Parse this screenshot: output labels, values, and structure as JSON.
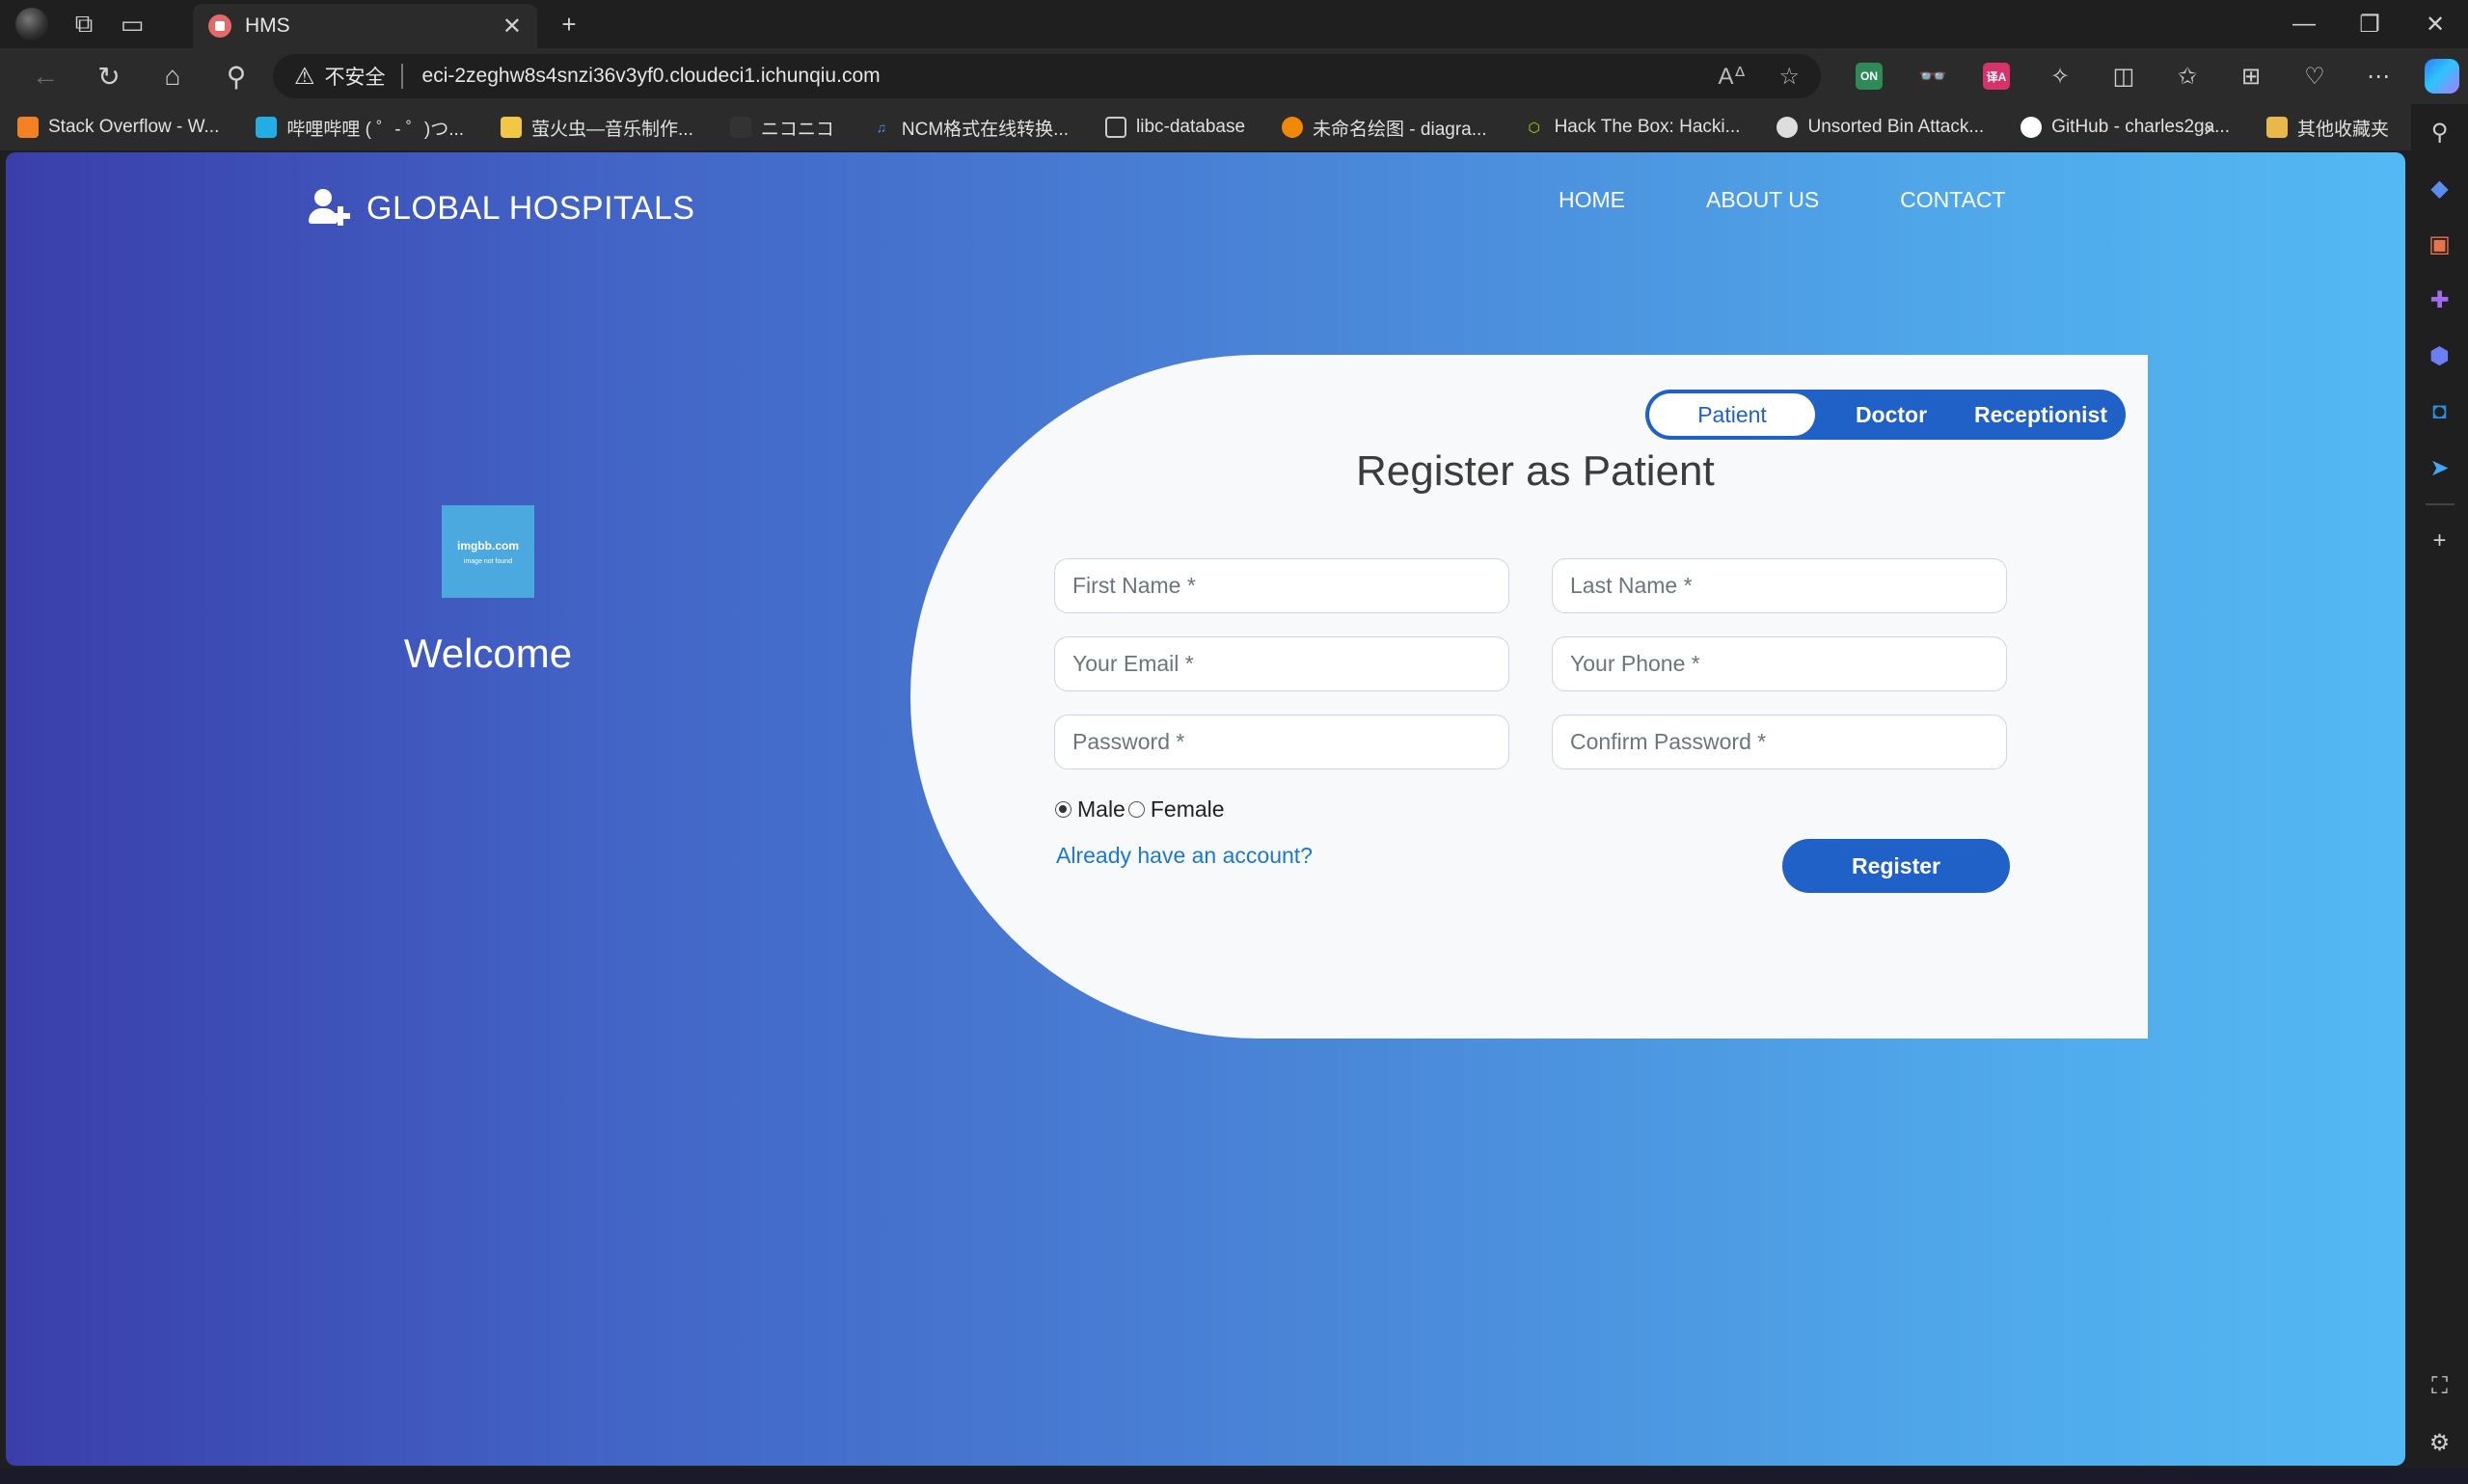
{
  "browser": {
    "tab_title": "HMS",
    "tab_close": "✕",
    "new_tab": "+",
    "insecure_label": "不安全",
    "url": "eci-2zeghw8s4snzi36v3yf0.cloudeci1.ichunqiu.com",
    "minimize": "—",
    "restore": "❐",
    "close": "✕",
    "bookmarks": [
      {
        "label": "Stack Overflow - W...",
        "icon": "stackoverflow-icon",
        "color": "#f48024"
      },
      {
        "label": "哔哩哔哩 ( ゜- ゜)つ...",
        "icon": "bilibili-icon",
        "color": "#23ade5"
      },
      {
        "label": "萤火虫—音乐制作...",
        "icon": "envelope-icon",
        "color": "#f2c744"
      },
      {
        "label": "ニコニコ",
        "icon": "niconico-icon",
        "color": "#333333"
      },
      {
        "label": "NCM格式在线转换...",
        "icon": "music-note-icon",
        "color": "#4a90e2"
      },
      {
        "label": "libc-database",
        "icon": "page-icon",
        "color": "#cccccc"
      },
      {
        "label": "未命名绘图 - diagra...",
        "icon": "drawio-icon",
        "color": "#f08705"
      },
      {
        "label": "Hack The Box: Hacki...",
        "icon": "hackthebox-icon",
        "color": "#9fef00"
      },
      {
        "label": "Unsorted Bin Attack...",
        "icon": "ctf-wiki-icon",
        "color": "#dddddd"
      },
      {
        "label": "GitHub - charles2ga...",
        "icon": "github-icon",
        "color": "#ffffff"
      }
    ],
    "other_bookmarks": "其他收藏夹",
    "extension_badge_on": "ON",
    "extension_badge_translate": "译A"
  },
  "site": {
    "brand_name": "GLOBAL HOSPITALS",
    "nav": {
      "home": "HOME",
      "about": "ABOUT US",
      "contact": "CONTACT"
    },
    "welcome": {
      "img_site": "imgbb.com",
      "img_message": "image not found",
      "title": "Welcome"
    }
  },
  "form": {
    "roles": {
      "patient": "Patient",
      "doctor": "Doctor",
      "receptionist": "Receptionist"
    },
    "title": "Register as Patient",
    "fields": {
      "first_name": "First Name *",
      "last_name": "Last Name *",
      "email": "Your Email *",
      "phone": "Your Phone *",
      "password": "Password *",
      "confirm_password": "Confirm Password *"
    },
    "gender": {
      "male": "Male",
      "female": "Female",
      "selected": "male"
    },
    "login_link": "Already have an account?",
    "submit_label": "Register"
  },
  "colors": {
    "primary": "#1f61c6",
    "link": "#1a78d4",
    "gradient_start": "#3a3eab",
    "gradient_end": "#53b9f4"
  }
}
